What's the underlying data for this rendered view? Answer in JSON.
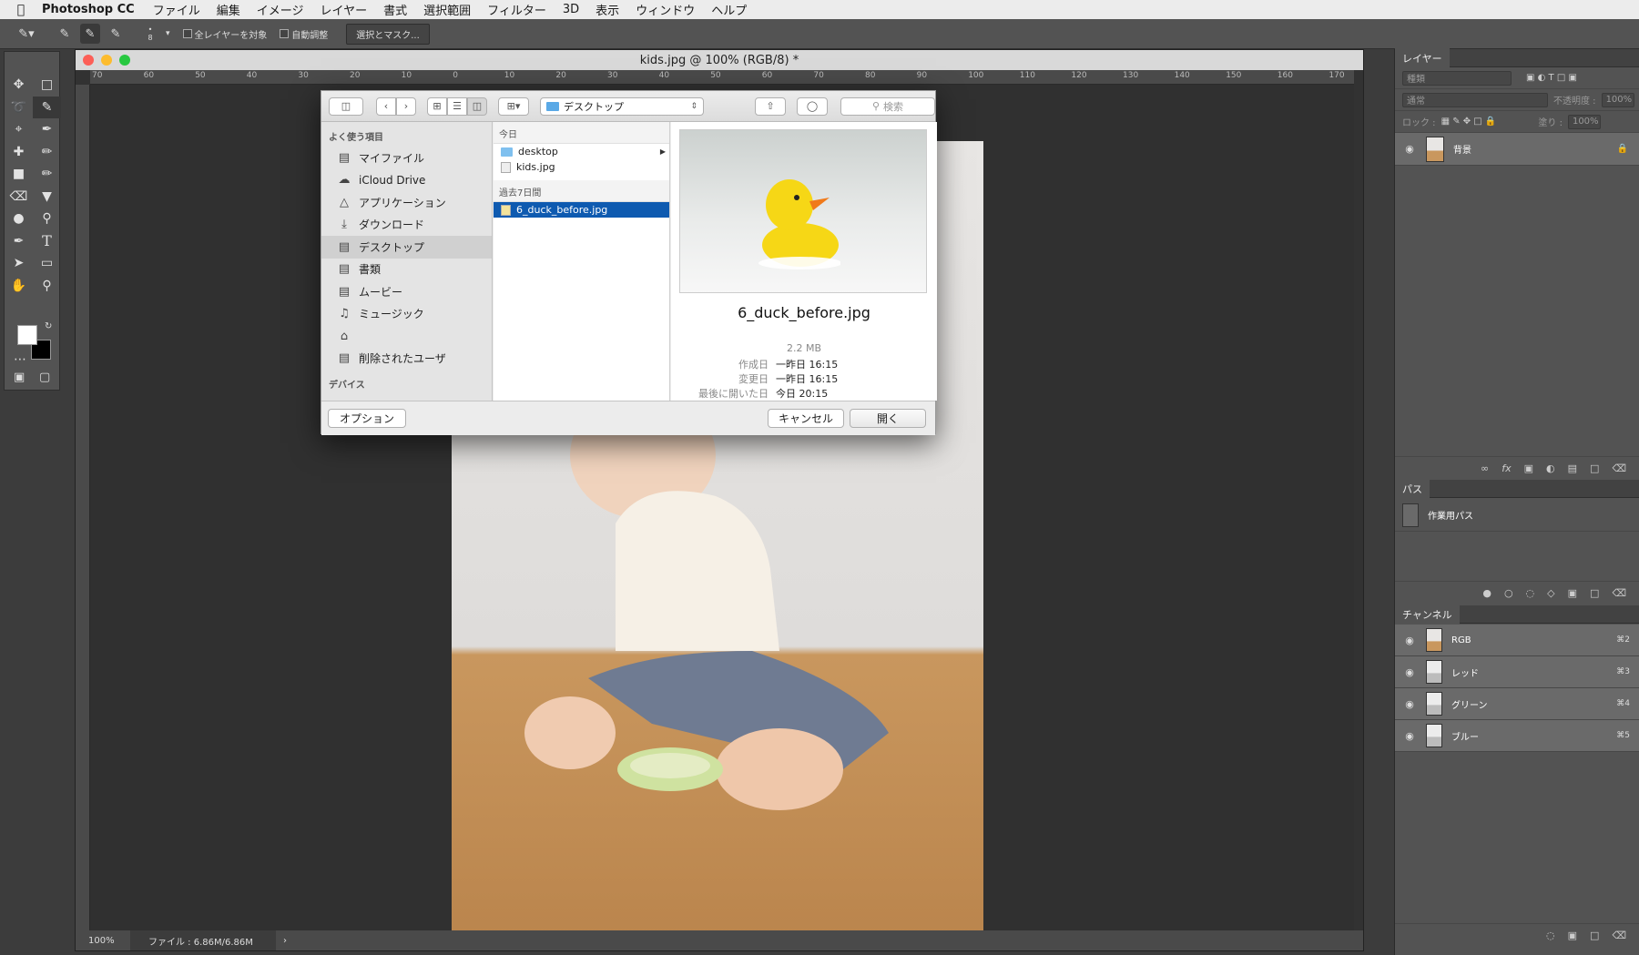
{
  "menubar": {
    "app": "Photoshop CC",
    "items": [
      "ファイル",
      "編集",
      "イメージ",
      "レイヤー",
      "書式",
      "選択範囲",
      "フィルター",
      "3D",
      "表示",
      "ウィンドウ",
      "ヘルプ"
    ]
  },
  "options": {
    "brush_size": "8",
    "all_layers": "全レイヤーを対象",
    "auto_enhance": "自動調整",
    "select_mask": "選択とマスク..."
  },
  "document": {
    "title": "kids.jpg @ 100% (RGB/8) *",
    "ruler": [
      "70",
      "60",
      "50",
      "40",
      "30",
      "20",
      "10",
      "0",
      "10",
      "20",
      "30",
      "40",
      "50",
      "60",
      "70",
      "80",
      "90",
      "100",
      "110",
      "120",
      "130",
      "140",
      "150",
      "160",
      "170"
    ],
    "zoom": "100%",
    "file_info": "ファイル : 6.86M/6.86M"
  },
  "dialog": {
    "location": "デスクトップ",
    "search_placeholder": "検索",
    "sidebar_favorites": "よく使う項目",
    "sidebar_items": [
      {
        "label": "マイファイル",
        "icon": "all-files-icon"
      },
      {
        "label": "iCloud Drive",
        "icon": "cloud-icon"
      },
      {
        "label": "アプリケーション",
        "icon": "applications-icon"
      },
      {
        "label": "ダウンロード",
        "icon": "download-icon"
      },
      {
        "label": "デスクトップ",
        "icon": "desktop-icon"
      },
      {
        "label": "書類",
        "icon": "documents-icon"
      },
      {
        "label": "ムービー",
        "icon": "movies-icon"
      },
      {
        "label": "ミュージック",
        "icon": "music-icon"
      },
      {
        "label": "",
        "icon": "home-icon"
      },
      {
        "label": "削除されたユーザ",
        "icon": "folder-icon"
      }
    ],
    "sidebar_devices": "デバイス",
    "col_today": "今日",
    "today_items": [
      {
        "name": "desktop",
        "type": "folder"
      },
      {
        "name": "kids.jpg",
        "type": "image"
      }
    ],
    "col_past7": "過去7日間",
    "past7_items": [
      {
        "name": "6_duck_before.jpg",
        "type": "image"
      }
    ],
    "preview": {
      "name": "6_duck_before.jpg",
      "size": "2.2 MB",
      "rows": [
        {
          "key": "作成日",
          "value": "一昨日 16:15"
        },
        {
          "key": "変更日",
          "value": "一昨日 16:15"
        },
        {
          "key": "最後に開いた日",
          "value": "今日 20:15"
        }
      ]
    },
    "options_button": "オプション",
    "cancel_button": "キャンセル",
    "open_button": "開く"
  },
  "layers": {
    "tab": "レイヤー",
    "kind_placeholder": "種類",
    "blend_mode": "通常",
    "opacity_label": "不透明度 :",
    "opacity_value": "100%",
    "lock_label": "ロック :",
    "fill_label": "塗り :",
    "fill_value": "100%",
    "layer_name": "背景"
  },
  "paths": {
    "tab": "パス",
    "work_path": "作業用パス"
  },
  "channels": {
    "tab": "チャンネル",
    "items": [
      {
        "name": "RGB",
        "shortcut": "⌘2"
      },
      {
        "name": "レッド",
        "shortcut": "⌘3"
      },
      {
        "name": "グリーン",
        "shortcut": "⌘4"
      },
      {
        "name": "ブルー",
        "shortcut": "⌘5"
      }
    ]
  },
  "colors": {
    "selection": "#0e5ab0",
    "close": "#fc5f57",
    "minimize": "#fdbc2e",
    "zoom": "#28c840"
  }
}
